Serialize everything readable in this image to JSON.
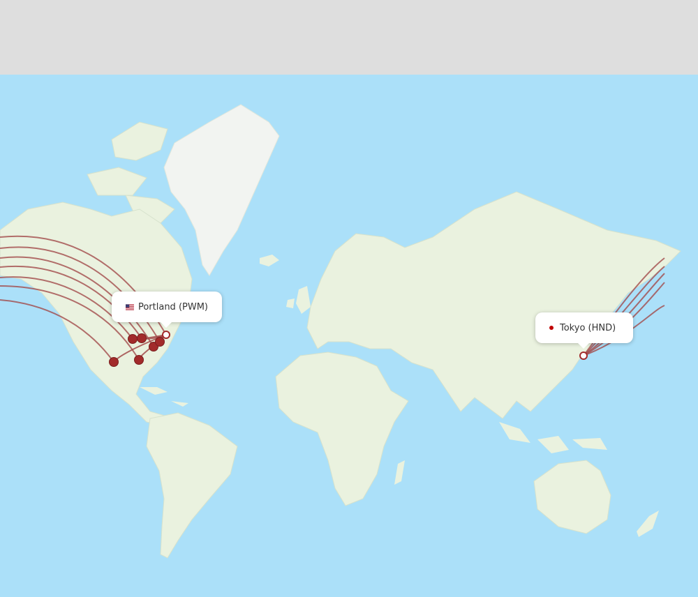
{
  "origin": {
    "label": "Portland (PWM)",
    "icon": "us-flag-icon"
  },
  "destination": {
    "label": "Tokyo (HND)",
    "icon": "red-dot-icon"
  },
  "colors": {
    "ocean": "#abe0f9",
    "land": "#eaf2df",
    "greenland": "#f2f4f1",
    "route": "#a24b4b",
    "stop": "#a22b2b",
    "header": "#dedede"
  }
}
